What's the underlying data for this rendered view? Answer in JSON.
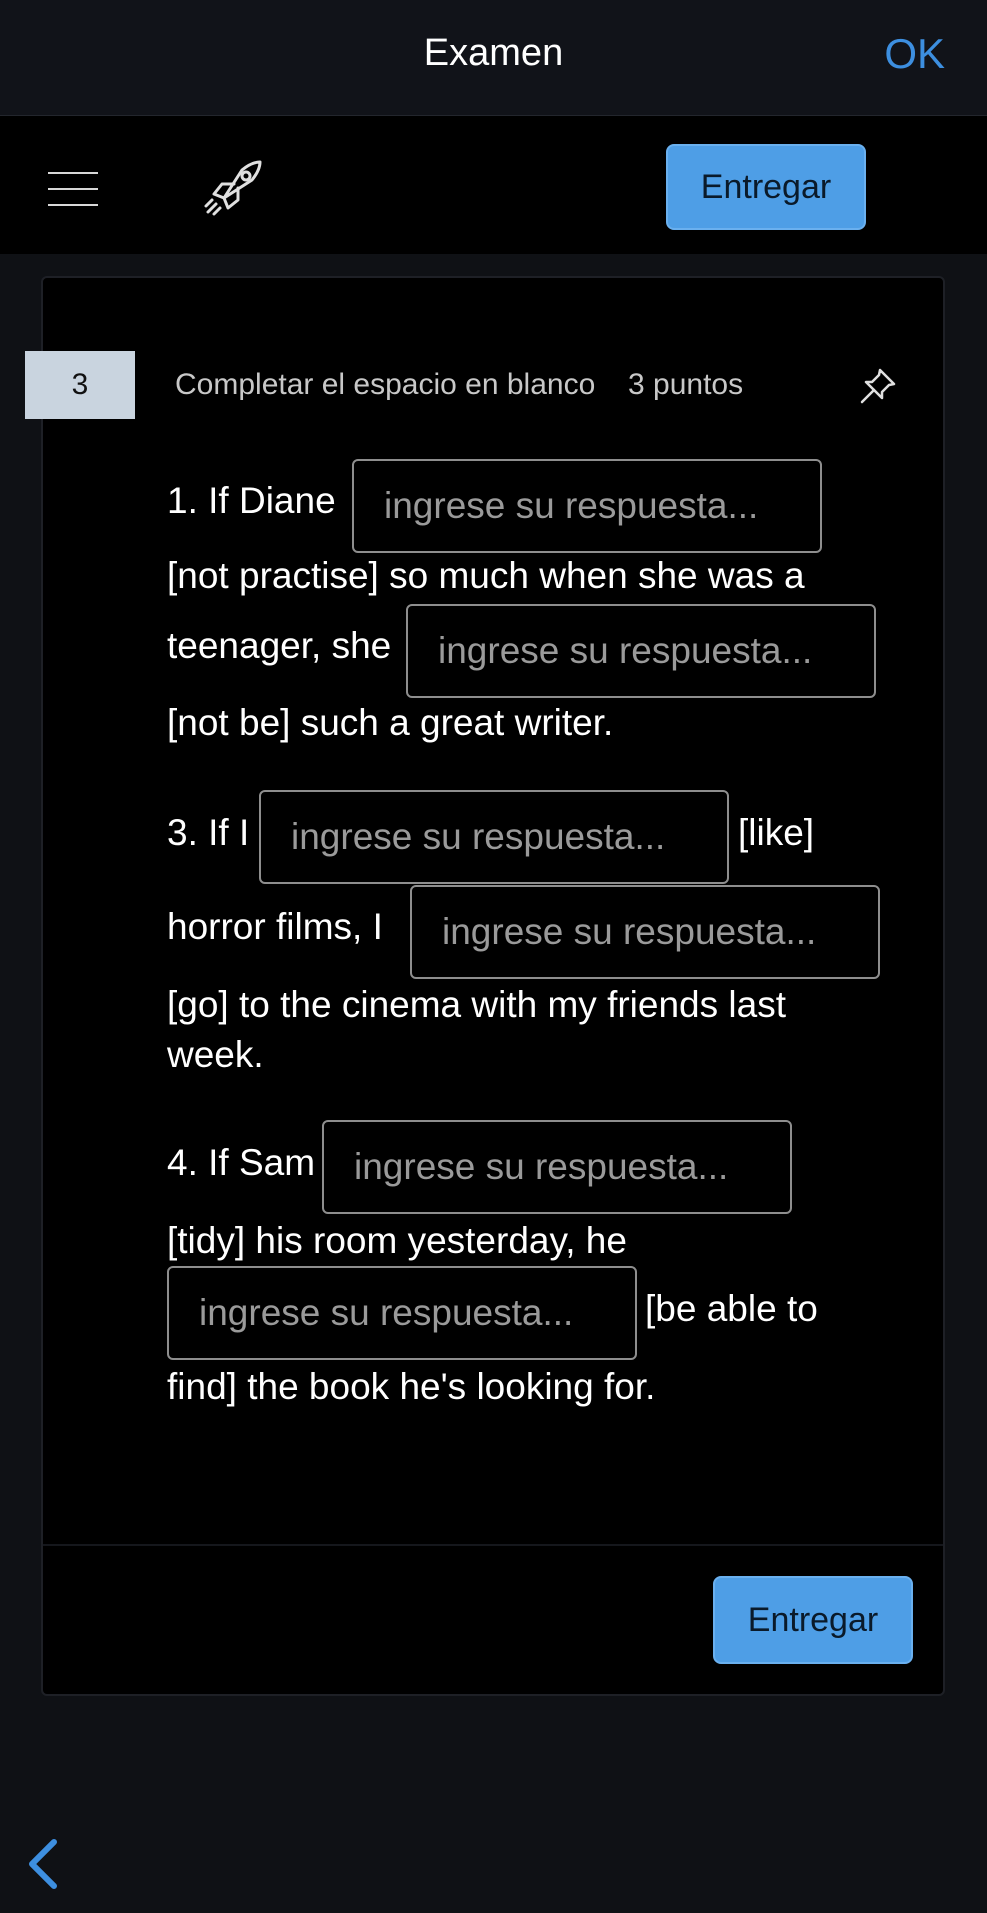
{
  "header": {
    "title": "Examen",
    "ok_label": "OK"
  },
  "toolbar": {
    "menu_icon": "hamburger-menu-icon",
    "rocket_icon": "rocket-icon",
    "submit_label": "Entregar"
  },
  "question": {
    "number": "3",
    "type": "Completar el espacio en blanco",
    "points": "3 puntos",
    "pin_icon": "pin-icon",
    "placeholder": "ingrese su respuesta...",
    "text": {
      "q1_a": "1. If Diane",
      "q1_b": "[not practise] so much when she was a",
      "q1_c": "teenager, she",
      "q1_d": "[not be] such a great writer.",
      "q3_a": "3. If I",
      "q3_b": "[like]",
      "q3_c": "horror films, I",
      "q3_d": "[go] to the cinema with my friends last",
      "q3_e": "week.",
      "q4_a": "4. If Sam",
      "q4_b": "[tidy] his room yesterday, he",
      "q4_c": "[be able to",
      "q4_d": "find] the book he's looking for."
    },
    "answers": [
      "",
      "",
      "",
      "",
      "",
      ""
    ]
  },
  "footer": {
    "submit_label": "Entregar",
    "back_icon": "chevron-left-icon"
  },
  "colors": {
    "accent": "#4e9ee6",
    "link": "#3d8fe0",
    "background": "#000000"
  }
}
